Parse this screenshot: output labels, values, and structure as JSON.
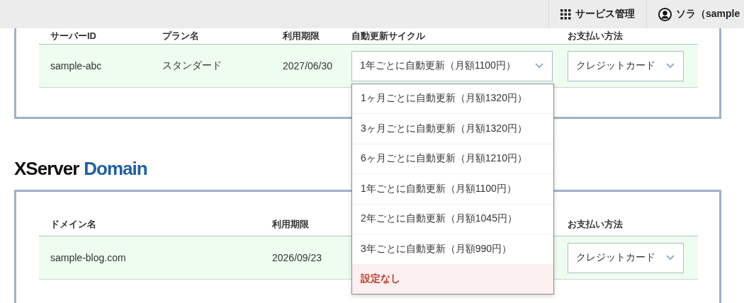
{
  "header": {
    "items": [
      {
        "kind": "services",
        "label": "サービス管理"
      },
      {
        "kind": "user",
        "label": "ソラ（sample"
      }
    ]
  },
  "server_table": {
    "columns": [
      "サーバーID",
      "プラン名",
      "利用期限",
      "自動更新サイクル",
      "お支払い方法"
    ],
    "row": {
      "server_id": "sample-abc",
      "plan": "スタンダード",
      "expiry": "2027/06/30",
      "renewal": "1年ごとに自動更新（月額1100円）",
      "payment": "クレジットカード"
    }
  },
  "renewal_dropdown": {
    "options": [
      {
        "label": "1ヶ月ごとに自動更新（月額1320円）",
        "highlighted": false
      },
      {
        "label": "3ヶ月ごとに自動更新（月額1320円）",
        "highlighted": false
      },
      {
        "label": "6ヶ月ごとに自動更新（月額1210円）",
        "highlighted": false
      },
      {
        "label": "1年ごとに自動更新（月額1100円）",
        "highlighted": false
      },
      {
        "label": "2年ごとに自動更新（月額1045円）",
        "highlighted": false
      },
      {
        "label": "3年ごとに自動更新（月額990円）",
        "highlighted": false
      },
      {
        "label": "設定なし",
        "highlighted": true
      }
    ]
  },
  "domain_section": {
    "logo": {
      "part_1": "XServer",
      "part_2": "Domain"
    },
    "columns": [
      "ドメイン名",
      "利用期限",
      "お支払い方法"
    ],
    "row": {
      "domain": "sample-blog.com",
      "expiry": "2026/09/23",
      "payment": "クレジットカード"
    }
  }
}
